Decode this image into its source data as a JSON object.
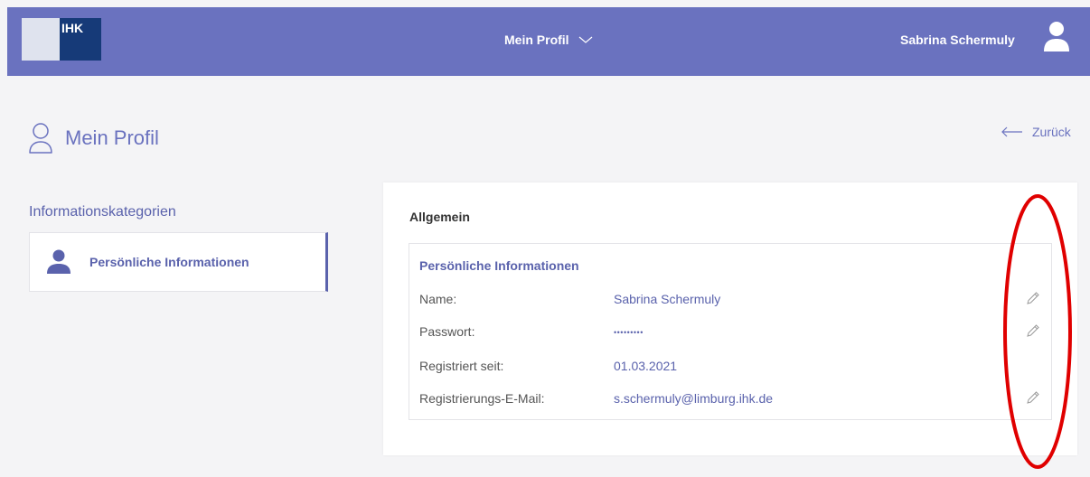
{
  "header": {
    "logo_text": "IHK",
    "nav_label": "Mein Profil",
    "user_name": "Sabrina Schermuly"
  },
  "page": {
    "title": "Mein Profil",
    "back_label": "Zurück"
  },
  "sidebar": {
    "heading": "Informationskategorien",
    "items": [
      {
        "label": "Persönliche Informationen"
      }
    ]
  },
  "card": {
    "title": "Allgemein",
    "section_title": "Persönliche Informationen",
    "rows": [
      {
        "label": "Name:",
        "value": "Sabrina Schermuly"
      },
      {
        "label": "Passwort:",
        "value": "•••••••••"
      },
      {
        "label": "Registriert seit:",
        "value": "01.03.2021"
      },
      {
        "label": "Registrierungs-E-Mail:",
        "value": "s.schermuly@limburg.ihk.de"
      }
    ]
  },
  "icons": {
    "user": "user-icon",
    "profile": "profile-outline-icon",
    "back": "arrow-left-icon",
    "edit": "pencil-icon",
    "chevron": "chevron-down-icon"
  },
  "colors": {
    "header_bg": "#6a72bf",
    "accent": "#5a62ac",
    "annotation": "#e00000"
  }
}
